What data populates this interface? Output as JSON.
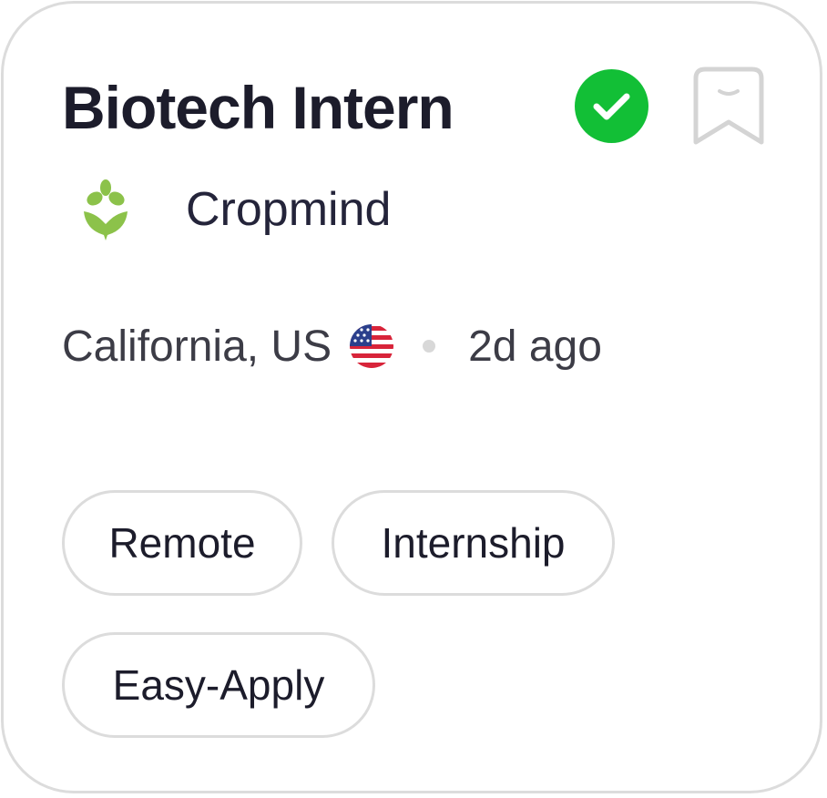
{
  "job": {
    "title": "Biotech Intern",
    "company": "Cropmind",
    "location": "California, US",
    "posted": "2d ago",
    "verified": true,
    "tags": [
      "Remote",
      "Internship",
      "Easy-Apply"
    ]
  },
  "icons": {
    "verified": "check-circle-icon",
    "bookmark": "bookmark-icon",
    "company_logo": "sprout-logo",
    "flag": "us-flag-icon"
  },
  "colors": {
    "verified_green": "#12bf36",
    "logo_green": "#8cc24a",
    "border_gray": "#dcdcdc",
    "text_dark": "#1c1c2b"
  }
}
